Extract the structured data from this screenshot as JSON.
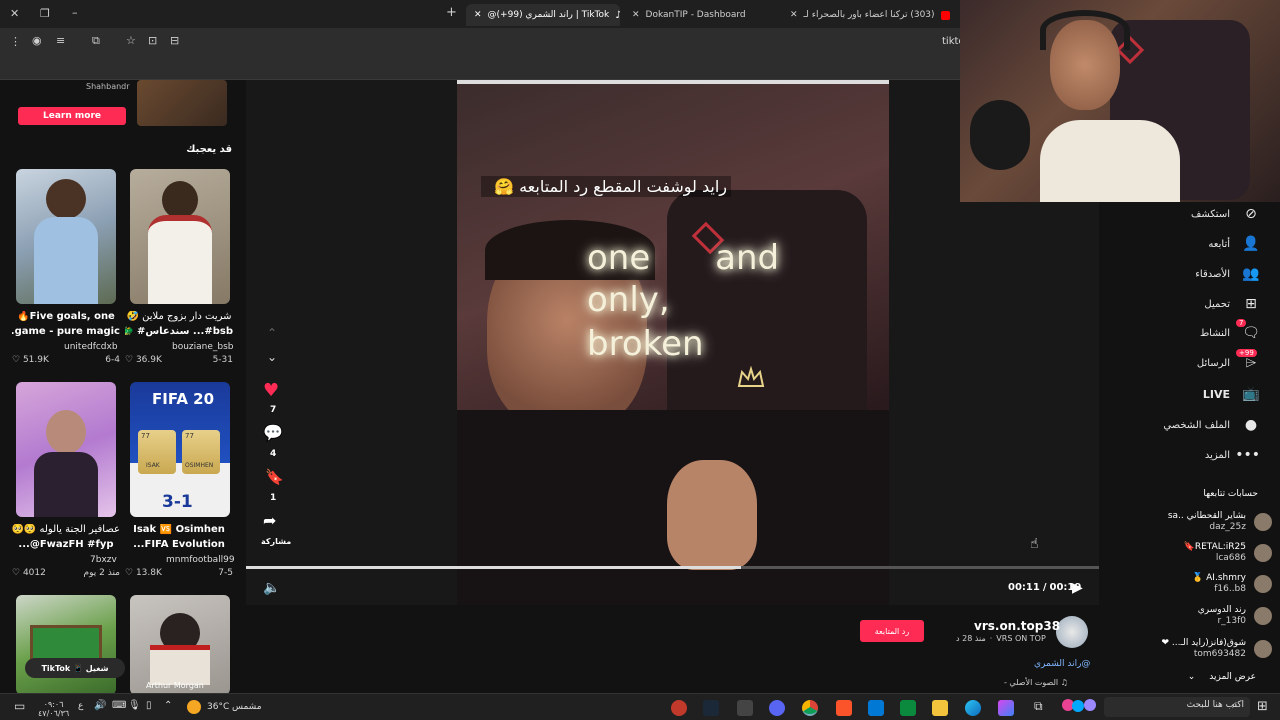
{
  "browser": {
    "tabs": [
      {
        "label": "(303) تركنا اعضاء باور بالصحراء لـ"
      },
      {
        "label": "DokanTIP - Dashboard"
      },
      {
        "label": "TikTok | راند الشمري (99+)@"
      }
    ],
    "address_text": "tiktc",
    "colors": {
      "youtube": "#ff0000",
      "tiktok": "#fe2c55",
      "accent": "#fe2c55"
    }
  },
  "ad": {
    "brand": "Shahbandr",
    "learn_more": "Learn more"
  },
  "left_panel": {
    "heading": "قد يعجبك",
    "videos": [
      {
        "title": "Five goals, one🔥",
        "subtitle": "game - pure magic...",
        "author": "unitedfcdxb",
        "likes": "51.9K",
        "date": "6-4"
      },
      {
        "title": "شريت دار بزوج ملاين 🤣",
        "subtitle": "bsb#... سندعاس# 🐲",
        "author": "bouziane_bsb",
        "likes": "36.9K",
        "date": "5-31"
      },
      {
        "title": "عصافير الجنة يالوله 🥺🥺",
        "subtitle": "FwazFH #fyp@...",
        "author": "7bxzv",
        "likes": "4012",
        "date": "منذ 2 يوم"
      },
      {
        "title": "Isak 🆚 Osimhen",
        "subtitle": "FIFA Evolution...",
        "author": "mnmfootball99",
        "likes": "13.8K",
        "date": "7-5"
      }
    ],
    "fifa_label": "FIFA 20",
    "fifa_score": "3-1",
    "player_label_1": "ISAK",
    "player_label_2": "OSIMHEN",
    "rating_1": "77",
    "rating_2": "77",
    "bottom_thumb_caption": "Arthur Morgan",
    "tiktok_button": "TikTok 📱 شغيل"
  },
  "video": {
    "caption_ar": "رايد لوشفت المقطع رد المتابعه 🤗",
    "neon_line1": "one      and",
    "neon_line2": "only,",
    "neon_line3": "broken",
    "time_current": "00:11",
    "time_total": "00:19",
    "time_sep": "/",
    "progress": 0.58
  },
  "actions": {
    "likes": "7",
    "comments": "4",
    "saves": "1",
    "share": "مشاركة"
  },
  "post": {
    "username": "vrs.on.top38",
    "display": "VRS ON TOP",
    "time": "منذ 28 د",
    "follow_back": "رد المتابعة",
    "mention": "@راند الشمري",
    "sound": "♫ الصوت الأصلي -"
  },
  "sidebar": {
    "nav": [
      {
        "label": "استكشف",
        "icon": "compass-icon",
        "glyph": "⊘"
      },
      {
        "label": "أتابعه",
        "icon": "following-icon",
        "glyph": "👤"
      },
      {
        "label": "الأصدقاء",
        "icon": "friends-icon",
        "glyph": "👥"
      },
      {
        "label": "تحميل",
        "icon": "upload-icon",
        "glyph": "⊞"
      },
      {
        "label": "النشاط",
        "icon": "activity-icon",
        "glyph": "🗨",
        "badge": "7"
      },
      {
        "label": "الرسائل",
        "icon": "messages-icon",
        "glyph": "⌲",
        "badge": "99+"
      },
      {
        "label": "LIVE",
        "icon": "live-icon",
        "glyph": "📺"
      },
      {
        "label": "الملف الشخصي",
        "icon": "profile-icon",
        "glyph": "●"
      },
      {
        "label": "المزيد",
        "icon": "more-icon",
        "glyph": "•••"
      }
    ],
    "following_heading": "حسابات تتابعها",
    "following": [
      {
        "name": "بشاير القحطاني ..sa",
        "handle": "daz_25z"
      },
      {
        "name": "RETAL:iR25🔖",
        "handle": "lca686"
      },
      {
        "name": "AI.shmry 🥇",
        "handle": "f16..b8"
      },
      {
        "name": "رند الدوسري",
        "handle": "r_13f0"
      },
      {
        "name": "شوق(فانز(رايد الـ... ❤",
        "handle": "tom693482"
      }
    ],
    "show_more": "عرض المزيد"
  },
  "taskbar": {
    "search": "اكتب هنا للبحث",
    "weather_temp": "36°C",
    "weather_label": "مشمس",
    "time": "٠٩:٠٦",
    "date": "٤٧/٠٦/٣٦",
    "lang": "ع"
  }
}
